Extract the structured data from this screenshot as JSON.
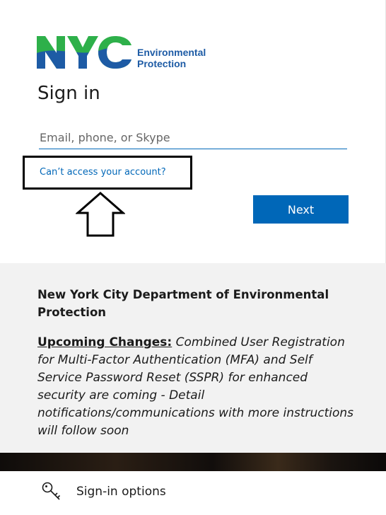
{
  "logo": {
    "mark_text": "NYC",
    "org_line1": "Environmental",
    "org_line2": "Protection",
    "colors": {
      "green": "#2eb04a",
      "blue": "#1d5ba5"
    }
  },
  "signin": {
    "title": "Sign in",
    "email_placeholder": "Email, phone, or Skype",
    "email_value": "",
    "cant_access_link": "Can’t access your account?",
    "next_label": "Next"
  },
  "annotation": {
    "highlight": "callout-box",
    "pointer": "up-arrow"
  },
  "info": {
    "org_name": "New York City Department of Environmental Protection",
    "notice_label": "Upcoming Changes:",
    "notice_body": "Combined User Registration for Multi-Factor Authentication (MFA) and Self Service Password Reset (SSPR) for enhanced security are coming - Detail notifications/communications with more instructions will follow soon"
  },
  "footer": {
    "signin_options_label": "Sign-in options",
    "icon": "key-icon"
  },
  "colors": {
    "accent": "#0067b8",
    "info_bg": "#f2f2f2",
    "text": "#1b1b1b"
  }
}
